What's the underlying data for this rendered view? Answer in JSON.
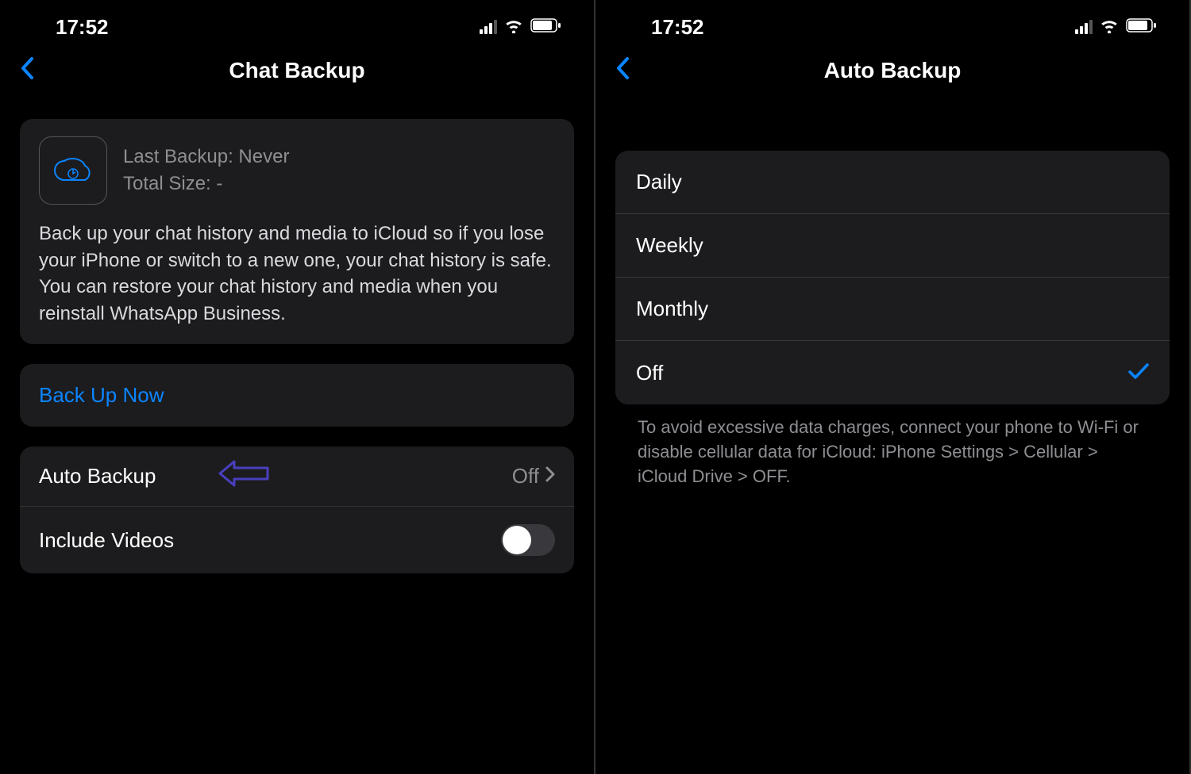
{
  "status": {
    "time": "17:52"
  },
  "screen1": {
    "title": "Chat Backup",
    "info": {
      "last_backup": "Last Backup: Never",
      "total_size": "Total Size: -",
      "description": "Back up your chat history and media to iCloud so if you lose your iPhone or switch to a new one, your chat history is safe. You can restore your chat history and media when you reinstall WhatsApp Business."
    },
    "backup_now_label": "Back Up Now",
    "rows": {
      "auto_backup_label": "Auto Backup",
      "auto_backup_value": "Off",
      "include_videos_label": "Include Videos"
    }
  },
  "screen2": {
    "title": "Auto Backup",
    "options": [
      {
        "label": "Daily",
        "selected": false
      },
      {
        "label": "Weekly",
        "selected": false
      },
      {
        "label": "Monthly",
        "selected": false
      },
      {
        "label": "Off",
        "selected": true
      }
    ],
    "footer": "To avoid excessive data charges, connect your phone to Wi-Fi or disable cellular data for iCloud: iPhone Settings > Cellular > iCloud Drive > OFF."
  }
}
